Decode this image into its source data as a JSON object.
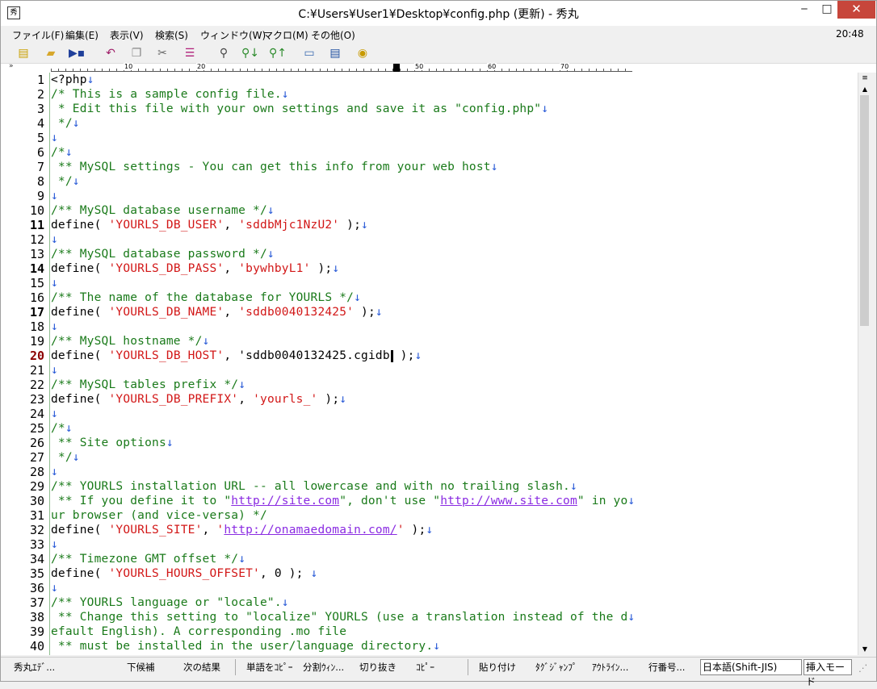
{
  "window": {
    "title": "C:¥Users¥User1¥Desktop¥config.php (更新) - 秀丸",
    "minimize_glyph": "‒",
    "maximize_glyph": "□",
    "close_glyph": "✕"
  },
  "menu": {
    "items": [
      "ファイル(F)",
      "編集(E)",
      "表示(V)",
      "検索(S)",
      "ウィンドウ(W)",
      "マクロ(M)",
      "その他(O)"
    ],
    "clock": "20:48"
  },
  "toolbar": {
    "icons": [
      "new-file-icon",
      "open-folder-icon",
      "save-icon",
      "undo-icon",
      "copy-icon",
      "cut-icon",
      "paste-icon",
      "search-icon",
      "find-next-icon",
      "find-prev-icon",
      "grep-icon",
      "split-window-icon",
      "help-icon"
    ]
  },
  "ruler": {
    "labels": [
      "10",
      "20",
      "50",
      "60",
      "70"
    ]
  },
  "editor": {
    "current_line": 20,
    "lines": [
      "1",
      "2",
      "3",
      "4",
      "5",
      "6",
      "7",
      "8",
      "9",
      "10",
      "11",
      "12",
      "13",
      "14",
      "15",
      "16",
      "17",
      "18",
      "19",
      "20",
      "21",
      "22",
      "23",
      "24",
      "25",
      "26",
      "27",
      "28",
      "29",
      "30",
      "31",
      "32",
      "33",
      "34",
      "35",
      "36",
      "37",
      "38",
      "39",
      "40"
    ]
  },
  "status": {
    "items": [
      "秀丸ｴﾃﾞ...",
      "下候補",
      "次の結果",
      "単語をｺﾋﾟｰ",
      "分割ｳｨﾝ...",
      "切り抜き",
      "ｺﾋﾟｰ",
      "貼り付け",
      "ﾀｸﾞｼﾞｬﾝﾌﾟ",
      "ｱｳﾄﾗｲﾝ...",
      "行番号..."
    ],
    "encoding": "日本語(Shift-JIS)",
    "mode": "挿入モード"
  },
  "colors": {
    "comment": "#1a7a1a",
    "string": "#d21717",
    "url": "#8a2be2",
    "newline_mark": "#2a5bd7",
    "close_button": "#c7463b"
  }
}
